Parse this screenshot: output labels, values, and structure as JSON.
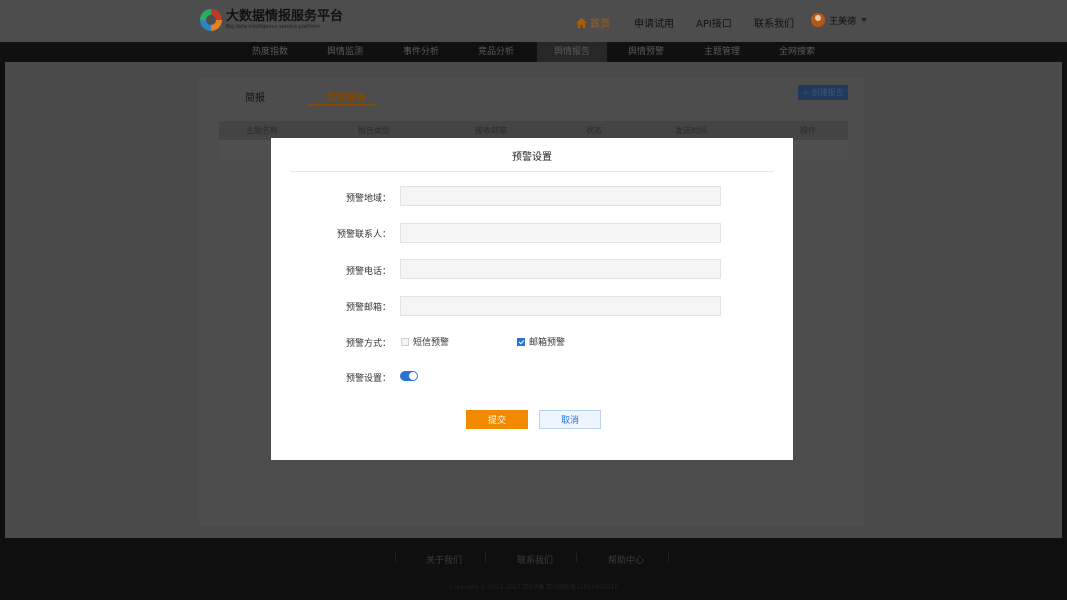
{
  "header": {
    "logo_title": "大数据情报服务平台",
    "logo_subtitle": "Big data intelligence service platform",
    "nav": [
      {
        "label": "首页",
        "icon": "home-icon"
      },
      {
        "label": "申请试用"
      },
      {
        "label": "API接口"
      },
      {
        "label": "联系我们"
      }
    ],
    "user_name": "王美德"
  },
  "main_nav": {
    "items": [
      "热度指数",
      "舆情监测",
      "事件分析",
      "竞品分析",
      "舆情报告",
      "舆情预警",
      "主题管理",
      "全网搜索"
    ],
    "active": "舆情报告"
  },
  "report_page": {
    "tabs": [
      "简报",
      "数据报告"
    ],
    "active_tab": "数据报告",
    "new_button": "+ 创建报告",
    "columns": [
      "主题名称",
      "报告类型",
      "接收邮箱",
      "状态",
      "发送时间",
      "操作"
    ]
  },
  "modal": {
    "title": "预警设置",
    "fields": [
      {
        "label": "预警地域：",
        "value": ""
      },
      {
        "label": "预警联系人：",
        "value": ""
      },
      {
        "label": "预警电话：",
        "value": ""
      },
      {
        "label": "预警邮箱：",
        "value": ""
      }
    ],
    "method_label": "预警方式：",
    "methods": [
      {
        "label": "短信预警",
        "checked": false
      },
      {
        "label": "邮箱预警",
        "checked": true
      }
    ],
    "switch_label": "预警设置：",
    "switch_on": true,
    "submit_label": "提交",
    "cancel_label": "取消"
  },
  "footer": {
    "links": [
      "关于我们",
      "联系我们",
      "帮助中心"
    ],
    "copyright": "Copyright © 2013-2017 京ICP备 京公网安备11010802015"
  },
  "colors": {
    "accent": "#f28a00",
    "primary": "#2a73d4"
  }
}
